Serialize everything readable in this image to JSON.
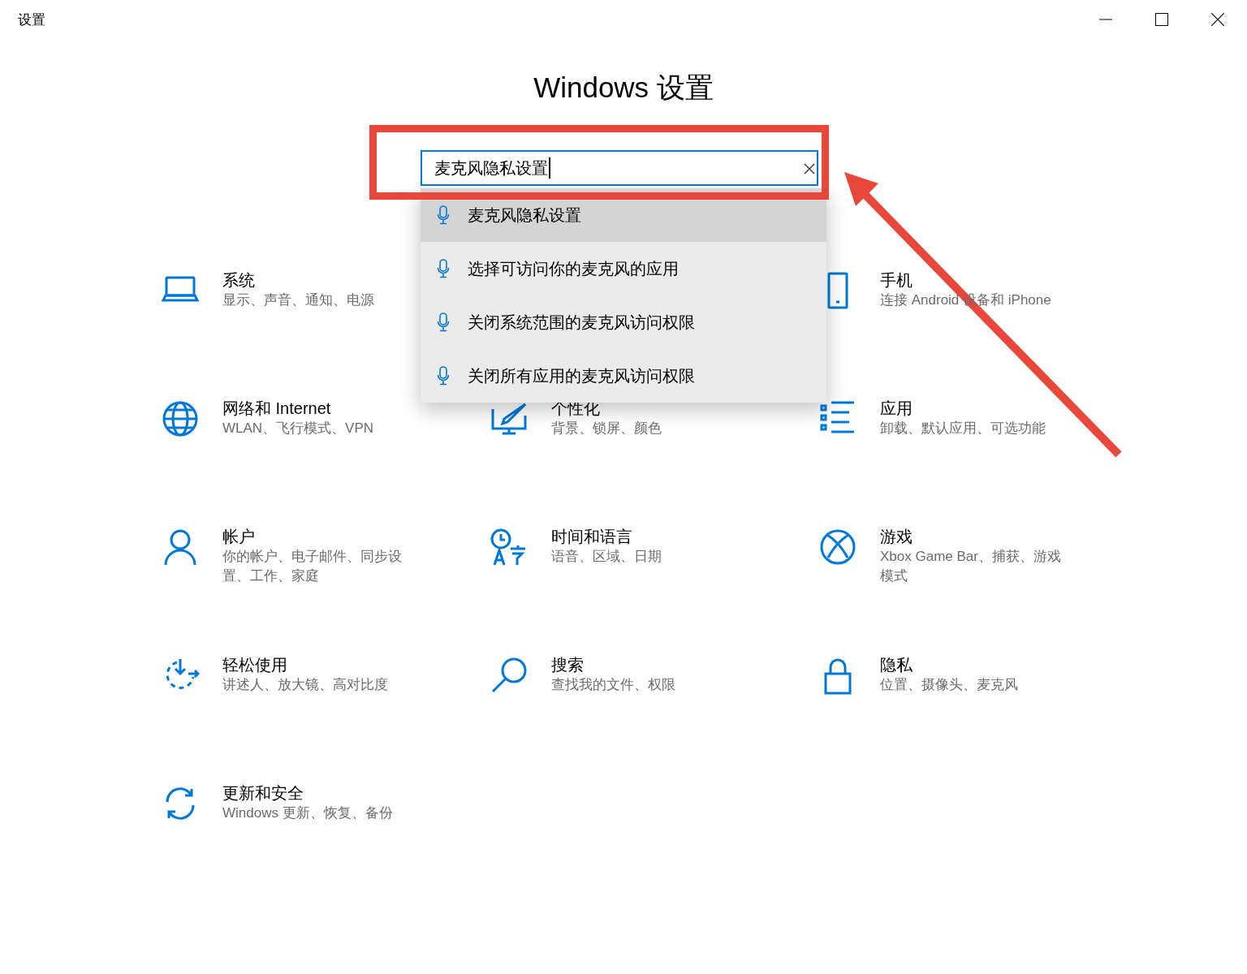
{
  "window": {
    "title": "设置"
  },
  "heading": "Windows 设置",
  "search": {
    "value": "麦克风隐私设置"
  },
  "suggestions": [
    {
      "label": "麦克风隐私设置",
      "selected": true
    },
    {
      "label": "选择可访问你的麦克风的应用",
      "selected": false
    },
    {
      "label": "关闭系统范围的麦克风访问权限",
      "selected": false
    },
    {
      "label": "关闭所有应用的麦克风访问权限",
      "selected": false
    }
  ],
  "tiles": [
    {
      "title": "系统",
      "description": "显示、声音、通知、电源"
    },
    {
      "title": "手机",
      "description": "连接 Android 设备和 iPhone"
    },
    {
      "title": "网络和 Internet",
      "description": "WLAN、飞行模式、VPN"
    },
    {
      "title": "个性化",
      "description": "背景、锁屏、颜色"
    },
    {
      "title": "应用",
      "description": "卸载、默认应用、可选功能"
    },
    {
      "title": "帐户",
      "description": "你的帐户、电子邮件、同步设置、工作、家庭"
    },
    {
      "title": "时间和语言",
      "description": "语音、区域、日期"
    },
    {
      "title": "游戏",
      "description": "Xbox Game Bar、捕获、游戏模式"
    },
    {
      "title": "轻松使用",
      "description": "讲述人、放大镜、高对比度"
    },
    {
      "title": "搜索",
      "description": "查找我的文件、权限"
    },
    {
      "title": "隐私",
      "description": "位置、摄像头、麦克风"
    },
    {
      "title": "更新和安全",
      "description": "Windows 更新、恢复、备份"
    }
  ]
}
